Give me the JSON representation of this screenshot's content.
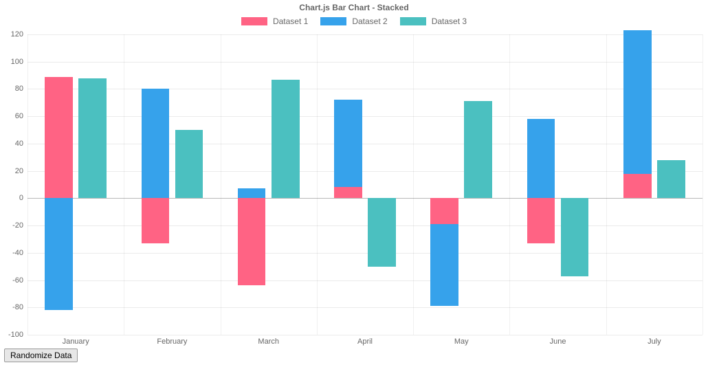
{
  "chart_data": {
    "type": "bar",
    "title": "Chart.js Bar Chart - Stacked",
    "categories": [
      "January",
      "February",
      "March",
      "April",
      "May",
      "June",
      "July"
    ],
    "series": [
      {
        "name": "Dataset 1",
        "stack": "A",
        "color": "#ff6384",
        "values": [
          89,
          -33,
          -64,
          8,
          -19,
          -33,
          18
        ]
      },
      {
        "name": "Dataset 2",
        "stack": "A",
        "color": "#36a2eb",
        "values": [
          -82,
          80,
          7,
          64,
          -60,
          58,
          105
        ]
      },
      {
        "name": "Dataset 3",
        "stack": "B",
        "color": "#4bc0c0",
        "values": [
          88,
          50,
          87,
          -50,
          71,
          -57,
          28
        ]
      }
    ],
    "legend": {
      "position": "top"
    },
    "ylim": [
      -100,
      120
    ],
    "yticks": [
      -100,
      -80,
      -60,
      -40,
      -20,
      0,
      20,
      40,
      60,
      80,
      100,
      120
    ],
    "xlabel": "",
    "ylabel": ""
  },
  "controls": {
    "randomize_label": "Randomize Data"
  }
}
